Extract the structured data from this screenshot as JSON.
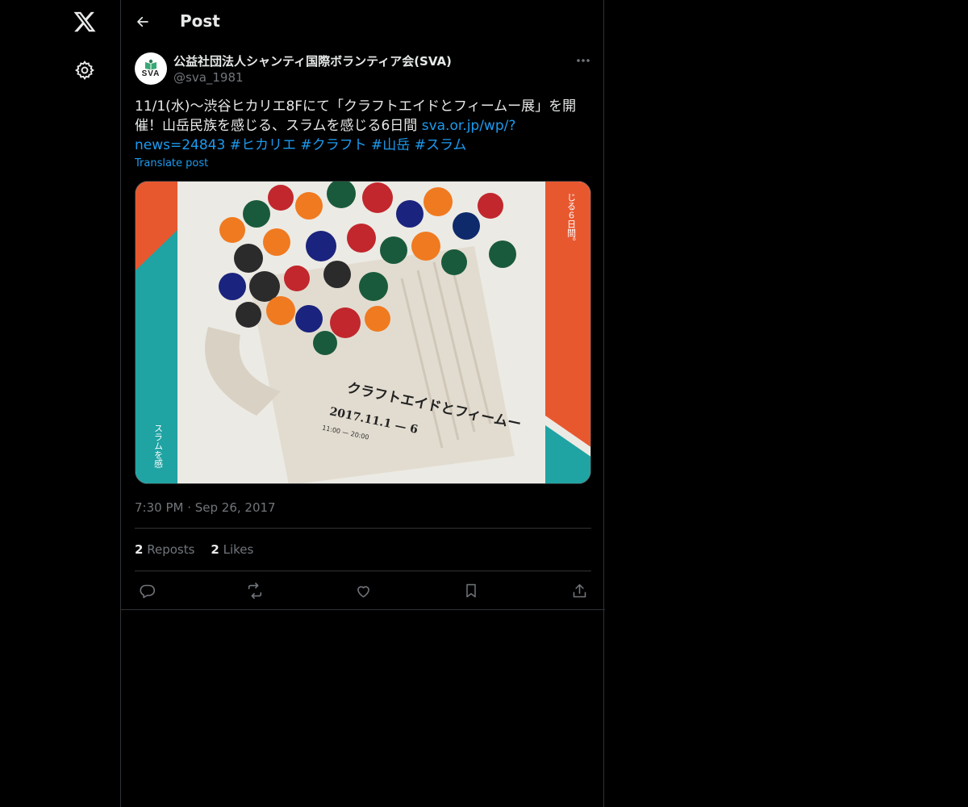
{
  "header": {
    "title": "Post"
  },
  "post": {
    "author": {
      "display_name": "公益社団法人シャンティ国際ボランティア会(SVA)",
      "handle": "@sva_1981",
      "avatar_text": "SVA"
    },
    "text_prefix": "11/1(水)〜渋谷ヒカリエ8Fにて「クラフトエイドとフィームー展」を開催！山岳民族を感じる、スラムを感じる6日間 ",
    "link": "sva.or.jp/wp/?news=24843",
    "hashtags": [
      "#ヒカリエ",
      "#クラフト",
      "#山岳",
      "#スラム"
    ],
    "translate_label": "Translate post",
    "timestamp": "7:30 PM · Sep 26, 2017",
    "media": {
      "poster_title": "クラフトエイドとフィームー",
      "poster_date": "2017.11.1 — 6",
      "poster_hours": "11:00 — 20:00",
      "poster_side_right": "じる６日間。",
      "poster_side_left": "スラムを感"
    },
    "stats": {
      "reposts_count": "2",
      "reposts_label": "Reposts",
      "likes_count": "2",
      "likes_label": "Likes"
    }
  },
  "colors": {
    "background": "#000000",
    "text": "#e7e9ea",
    "muted": "#71767b",
    "link": "#1d9bf0",
    "border": "#2f3336"
  },
  "icons": [
    "x-logo-icon",
    "gear-icon",
    "back-arrow-icon",
    "more-icon",
    "reply-icon",
    "repost-icon",
    "like-icon",
    "bookmark-icon",
    "share-icon"
  ]
}
